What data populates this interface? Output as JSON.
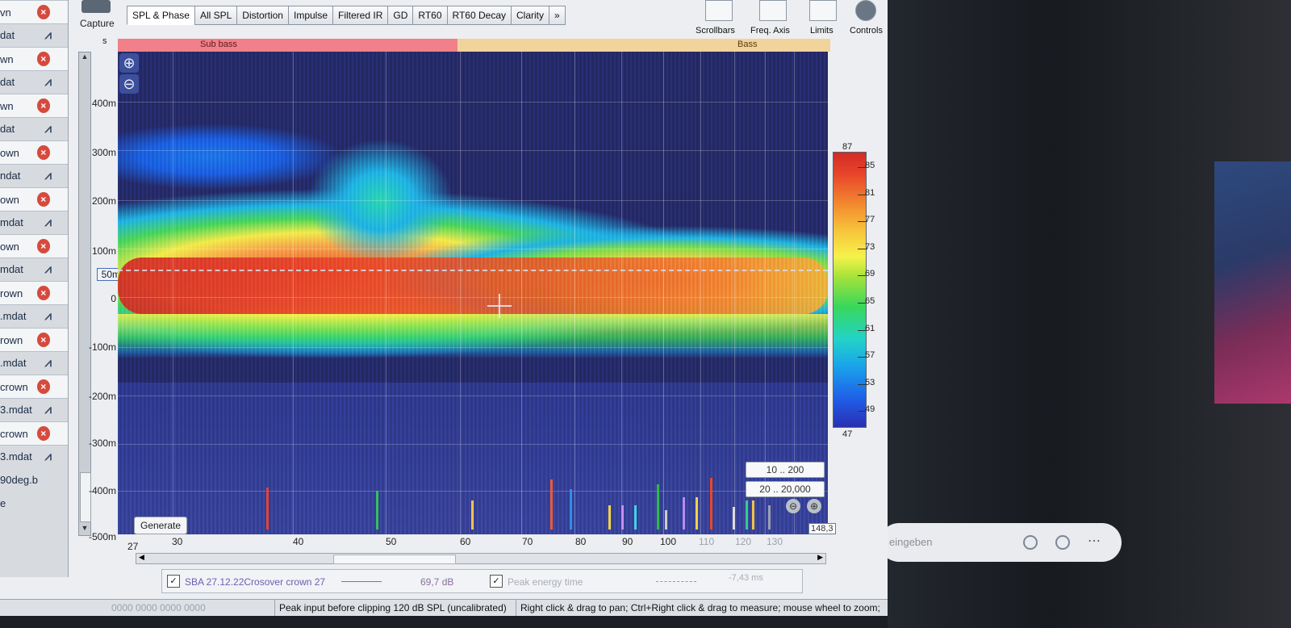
{
  "app": {
    "capture_label": "Capture",
    "tabs": [
      "SPL & Phase",
      "All SPL",
      "Distortion",
      "Impulse",
      "Filtered IR",
      "GD",
      "RT60",
      "RT60 Decay",
      "Clarity",
      "»"
    ],
    "tools": {
      "scrollbars": "Scrollbars",
      "freq_axis": "Freq. Axis",
      "limits": "Limits",
      "controls": "Controls"
    }
  },
  "sidebar": {
    "rows": [
      {
        "text": "vn",
        "kind": "name"
      },
      {
        "text": "dat",
        "kind": "file"
      },
      {
        "text": "wn",
        "kind": "name"
      },
      {
        "text": "dat",
        "kind": "file"
      },
      {
        "text": "wn",
        "kind": "name"
      },
      {
        "text": "dat",
        "kind": "file"
      },
      {
        "text": "own",
        "kind": "name"
      },
      {
        "text": "ndat",
        "kind": "file"
      },
      {
        "text": "own",
        "kind": "name"
      },
      {
        "text": "mdat",
        "kind": "file"
      },
      {
        "text": "own",
        "kind": "name"
      },
      {
        "text": "mdat",
        "kind": "file"
      },
      {
        "text": "rown",
        "kind": "name"
      },
      {
        "text": ".mdat",
        "kind": "file"
      },
      {
        "text": "rown",
        "kind": "name"
      },
      {
        "text": ".mdat",
        "kind": "file"
      },
      {
        "text": "crown",
        "kind": "name"
      },
      {
        "text": "3.mdat",
        "kind": "file"
      },
      {
        "text": "crown",
        "kind": "name"
      },
      {
        "text": "3.mdat",
        "kind": "file"
      },
      {
        "text": "90deg.b",
        "kind": "other"
      },
      {
        "text": "e",
        "kind": "other"
      }
    ]
  },
  "plot": {
    "units": "s",
    "bands": {
      "sub": "Sub bass",
      "bass": "Bass"
    },
    "y_labels": [
      "400m",
      "300m",
      "200m",
      "100m",
      "50m",
      "0",
      "-100m",
      "-200m",
      "-300m",
      "-400m",
      "-500m"
    ],
    "x_labels": [
      "27",
      "30",
      "40",
      "50",
      "60",
      "70",
      "80",
      "90",
      "100",
      "110",
      "120",
      "130"
    ],
    "x_max": "148,3",
    "generate_label": "Generate",
    "range_a": "10 .. 200",
    "range_b": "20 .. 20,000",
    "colorscale": {
      "top": "87",
      "bottom": "47",
      "ticks": [
        "85",
        "81",
        "77",
        "73",
        "69",
        "65",
        "61",
        "57",
        "53",
        "49"
      ]
    }
  },
  "legend": {
    "trace_name": "SBA 27.12.22Crosover crown 27",
    "trace_value": "69,7 dB",
    "peak_label": "Peak energy time",
    "peak_value": "-7,43 ms"
  },
  "status": {
    "left": "0000 0000  0000 0000",
    "peak": "Peak input before clipping 120 dB SPL (uncalibrated)",
    "hint": "Right click & drag to pan; Ctrl+Right click & drag to measure; mouse wheel to zoom;"
  },
  "search": {
    "placeholder": "eingeben"
  }
}
